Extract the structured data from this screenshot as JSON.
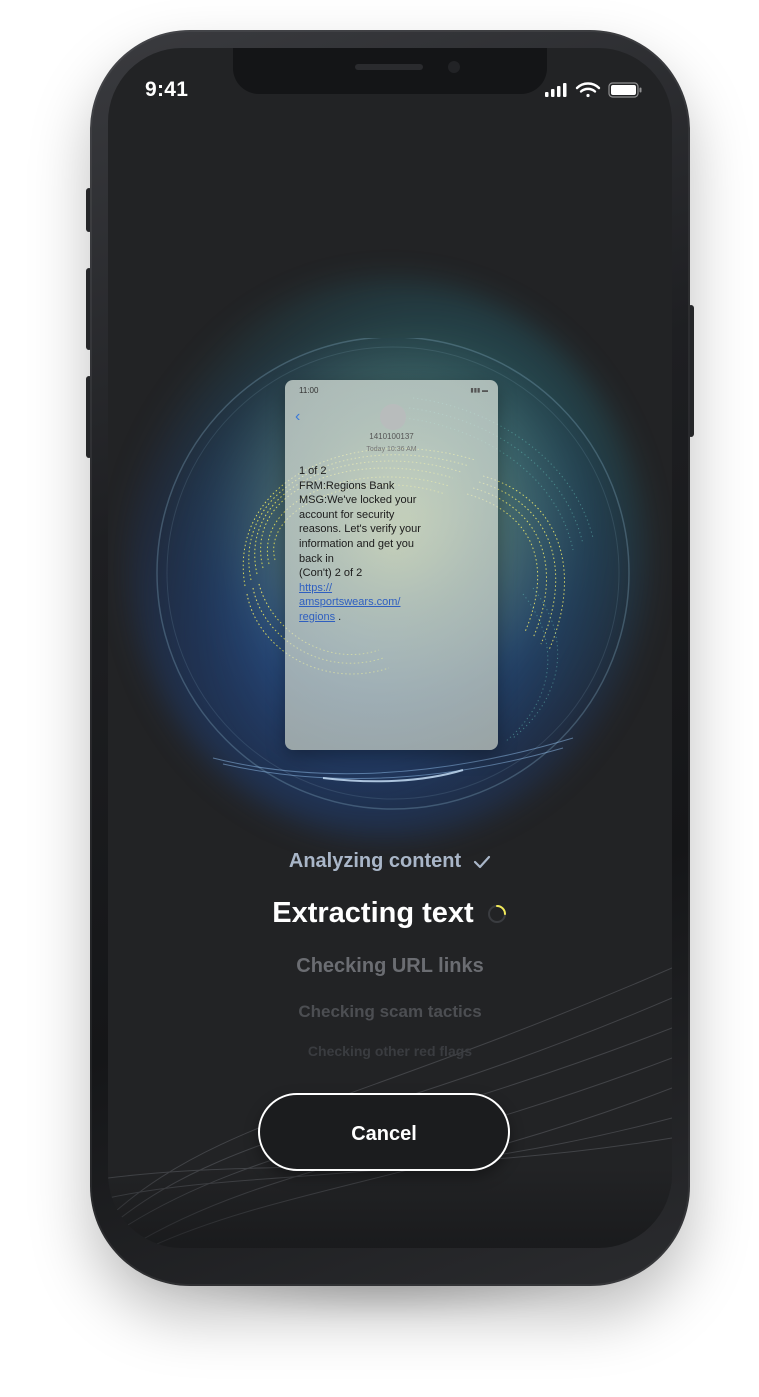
{
  "status_bar": {
    "time": "9:41",
    "icons": [
      "cellular-signal-icon",
      "wifi-icon",
      "battery-icon"
    ]
  },
  "message_preview": {
    "time": "11:00",
    "sender_number": "1410100137",
    "date": "Today 10:36 AM",
    "lines": [
      "1 of 2",
      "FRM:Regions Bank",
      "MSG:We've locked  your",
      "account for security",
      "reasons. Let's verify your",
      "information and get you",
      "back in",
      "(Con't) 2 of 2"
    ],
    "link_lines": [
      "https://",
      "amsportswears.com/",
      "regions"
    ],
    "link_suffix": " ."
  },
  "steps": [
    {
      "label": "Analyzing content",
      "state": "done"
    },
    {
      "label": "Extracting text",
      "state": "active"
    },
    {
      "label": "Checking URL links",
      "state": "pending"
    },
    {
      "label": "Checking scam tactics",
      "state": "pending"
    },
    {
      "label": "Checking other red flags",
      "state": "pending"
    }
  ],
  "cancel_button": {
    "label": "Cancel"
  },
  "colors": {
    "screen_bg": "#222325",
    "accent_yellow": "#f2ea5a",
    "glow_blue": "#2d5aa8",
    "glow_teal": "#2a8c9e",
    "done_text": "#a9b6c8"
  }
}
